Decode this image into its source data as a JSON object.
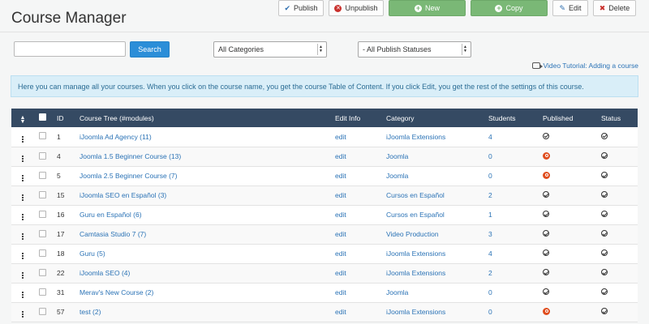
{
  "title": "Course Manager",
  "toolbar": {
    "publish": "Publish",
    "unpublish": "Unpublish",
    "new": "New",
    "copy": "Copy",
    "edit": "Edit",
    "delete": "Delete"
  },
  "filters": {
    "search_value": "",
    "search_button": "Search",
    "category": "All Categories",
    "publish_status": "- All Publish Statuses"
  },
  "tutorial_link": "Video Tutorial: Adding a course",
  "info_text": "Here you can manage all your courses. When you click on the course name, you get the course Table of Content. If you click Edit, you get the rest of the settings of this course.",
  "table": {
    "headers": {
      "id": "ID",
      "tree": "Course Tree (#modules)",
      "edit_info": "Edit Info",
      "category": "Category",
      "students": "Students",
      "published": "Published",
      "status": "Status"
    },
    "rows": [
      {
        "id": "1",
        "name": "iJoomla Ad Agency (11)",
        "edit": "edit",
        "category": "iJoomla Extensions",
        "students": "4",
        "published": true
      },
      {
        "id": "4",
        "name": "Joomla 1.5 Beginner Course (13)",
        "edit": "edit",
        "category": "Joomla",
        "students": "0",
        "published": false
      },
      {
        "id": "5",
        "name": "Joomla 2.5 Beginner Course (7)",
        "edit": "edit",
        "category": "Joomla",
        "students": "0",
        "published": false
      },
      {
        "id": "15",
        "name": "iJoomla SEO en Español (3)",
        "edit": "edit",
        "category": "Cursos en Español",
        "students": "2",
        "published": true
      },
      {
        "id": "16",
        "name": "Guru en Español (6)",
        "edit": "edit",
        "category": "Cursos en Español",
        "students": "1",
        "published": true
      },
      {
        "id": "17",
        "name": "Camtasia Studio 7 (7)",
        "edit": "edit",
        "category": "Video Production",
        "students": "3",
        "published": true
      },
      {
        "id": "18",
        "name": "Guru (5)",
        "edit": "edit",
        "category": "iJoomla Extensions",
        "students": "4",
        "published": true
      },
      {
        "id": "22",
        "name": "iJoomla SEO (4)",
        "edit": "edit",
        "category": "iJoomla Extensions",
        "students": "2",
        "published": true
      },
      {
        "id": "31",
        "name": "Merav's New Course (2)",
        "edit": "edit",
        "category": "Joomla",
        "students": "0",
        "published": true
      },
      {
        "id": "57",
        "name": "test (2)",
        "edit": "edit",
        "category": "iJoomla Extensions",
        "students": "0",
        "published": false
      }
    ]
  },
  "colors": {
    "header_bg": "#354a63",
    "link": "#2b73b6",
    "info_bg": "#d9eef8",
    "green_button": "#7ab876",
    "search_button": "#2b8ed8",
    "unpublished": "#e04d1e"
  }
}
